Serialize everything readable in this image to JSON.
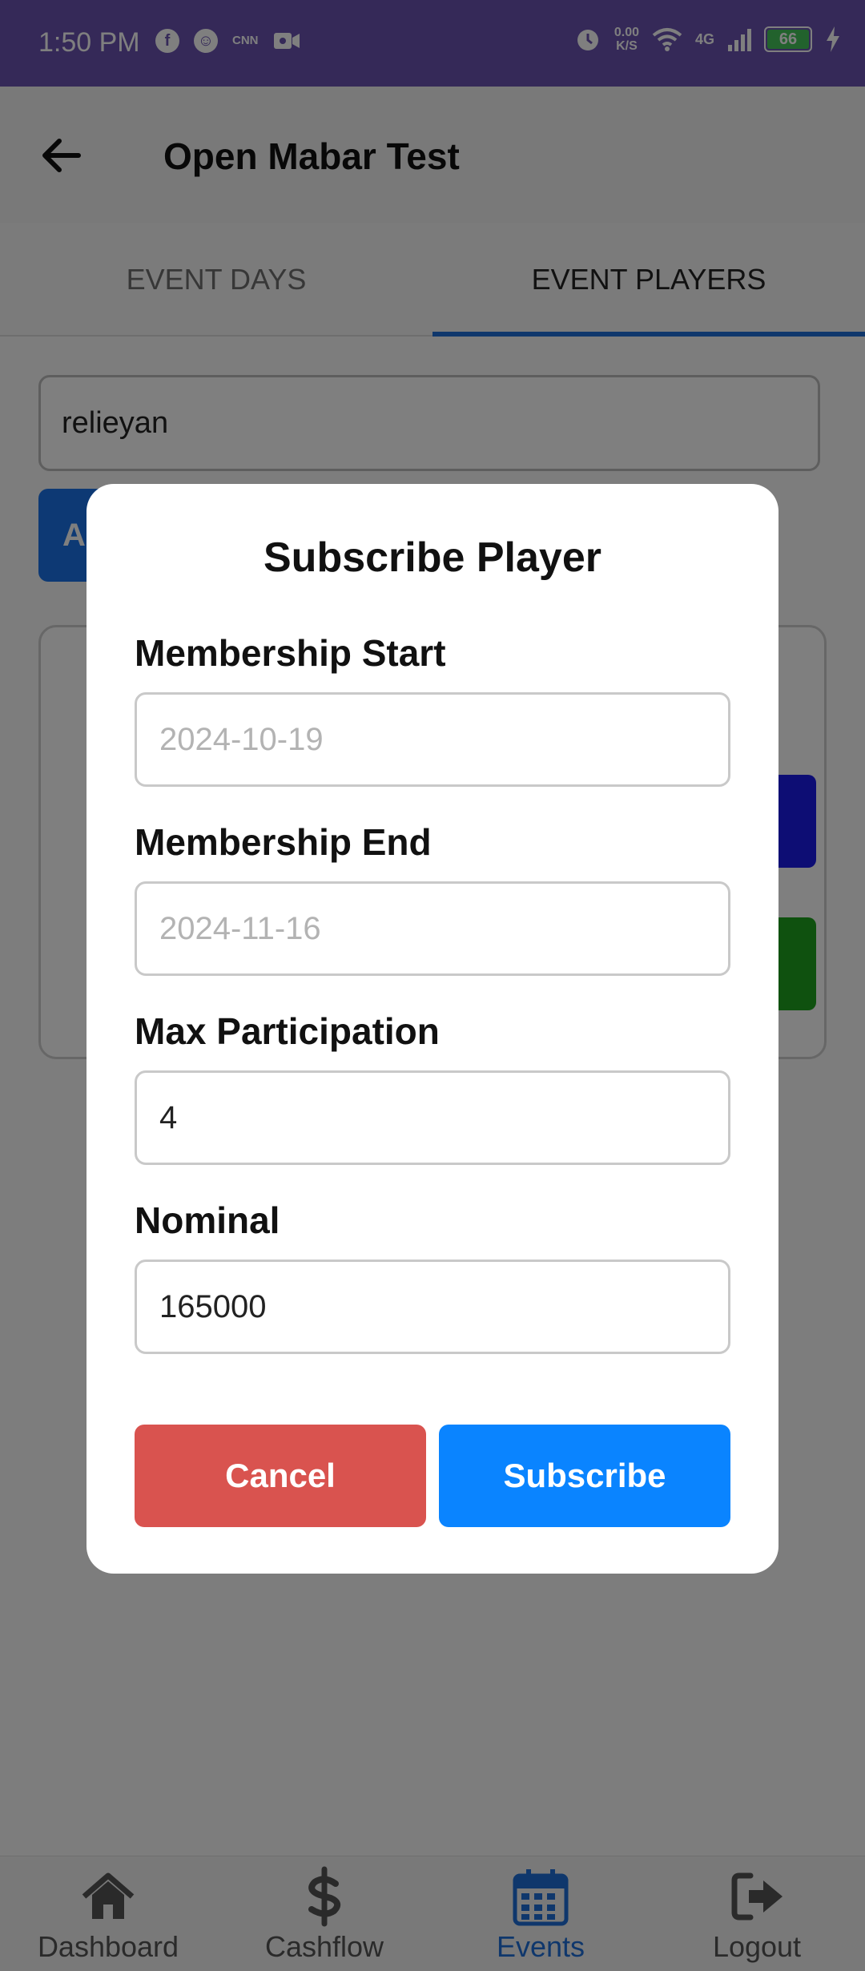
{
  "status_bar": {
    "time": "1:50 PM",
    "network_speed_value": "0.00",
    "network_speed_unit": "K/S",
    "network_type": "4G",
    "battery_level": "66"
  },
  "app_bar": {
    "title": "Open Mabar Test"
  },
  "tabs": [
    {
      "label": "EVENT DAYS",
      "active": false
    },
    {
      "label": "EVENT PLAYERS",
      "active": true
    }
  ],
  "background": {
    "search_value": "relieyan",
    "add_button_label_partial": "A"
  },
  "modal": {
    "title": "Subscribe Player",
    "fields": [
      {
        "label": "Membership Start",
        "placeholder": "2024-10-19",
        "value": ""
      },
      {
        "label": "Membership End",
        "placeholder": "2024-11-16",
        "value": ""
      },
      {
        "label": "Max Participation",
        "value": "4"
      },
      {
        "label": "Nominal",
        "value": "165000"
      }
    ],
    "cancel_label": "Cancel",
    "subscribe_label": "Subscribe"
  },
  "bottom_nav": [
    {
      "label": "Dashboard",
      "icon": "home-icon",
      "active": false
    },
    {
      "label": "Cashflow",
      "icon": "dollar-icon",
      "active": false
    },
    {
      "label": "Events",
      "icon": "calendar-icon",
      "active": true
    },
    {
      "label": "Logout",
      "icon": "logout-icon",
      "active": false
    }
  ],
  "colors": {
    "status_bar": "#6a52b1",
    "accent": "#1e6fd9",
    "cancel": "#d9534f",
    "subscribe": "#0a84ff"
  }
}
